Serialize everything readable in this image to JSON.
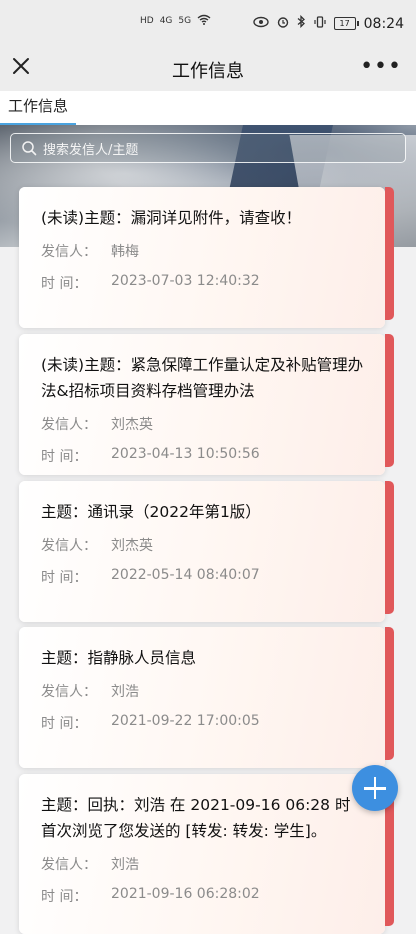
{
  "status_bar": {
    "network_labels": [
      "HD",
      "4G",
      "5G"
    ],
    "battery": "17",
    "time": "08:24"
  },
  "nav": {
    "title": "工作信息",
    "more": "•••"
  },
  "tabs": [
    {
      "label": "工作信息",
      "active": true
    }
  ],
  "search": {
    "placeholder": "搜索发信人/主题"
  },
  "labels": {
    "sender": "发信人：",
    "time": "时 间："
  },
  "messages": [
    {
      "subject": "(未读)主题：漏洞详见附件，请查收！",
      "sender": "韩梅",
      "time": "2023-07-03 12:40:32"
    },
    {
      "subject": "(未读)主题：紧急保障工作量认定及补贴管理办法&招标项目资料存档管理办法",
      "sender": "刘杰英",
      "time": "2023-04-13 10:50:56"
    },
    {
      "subject": "主题：通讯录（2022年第1版）",
      "sender": "刘杰英",
      "time": "2022-05-14 08:40:07"
    },
    {
      "subject": "主题：指静脉人员信息",
      "sender": "刘浩",
      "time": "2021-09-22 17:00:05"
    },
    {
      "subject": "主题：回执：刘浩 在 2021-09-16 06:28 时首次浏览了您发送的 [转发: 转发: 学生]。",
      "sender": "刘浩",
      "time": "2021-09-16 06:28:02"
    }
  ],
  "colors": {
    "accent": "#3d8fe0",
    "card_stripe": "#e0585a",
    "tab_underline": "#4aa3df"
  }
}
